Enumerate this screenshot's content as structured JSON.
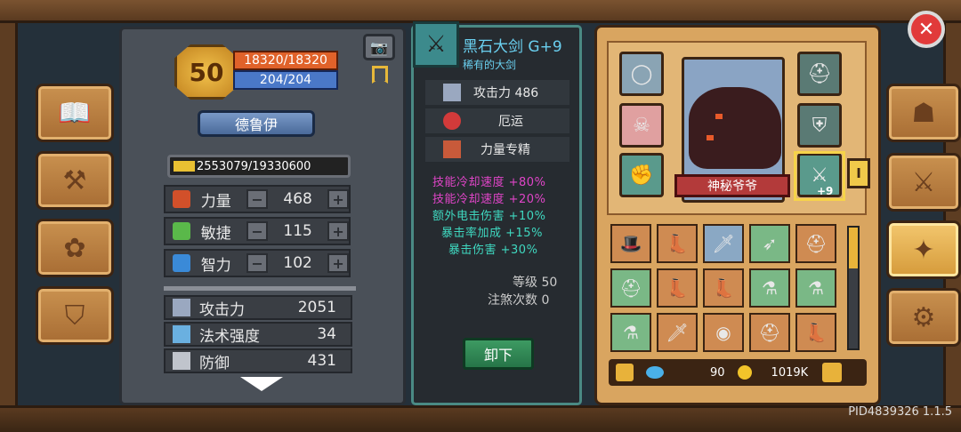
{
  "close": {
    "icon": "close-icon"
  },
  "player": {
    "level": "50",
    "hp": "18320/18320",
    "mp": "204/204",
    "class": "德鲁伊",
    "xp": "2553079/19330600"
  },
  "attributes": [
    {
      "label": "力量",
      "value": "468"
    },
    {
      "label": "敏捷",
      "value": "115"
    },
    {
      "label": "智力",
      "value": "102"
    }
  ],
  "attr_buttons": {
    "minus": "−",
    "plus": "+"
  },
  "stats": [
    {
      "label": "攻击力",
      "value": "2051"
    },
    {
      "label": "法术强度",
      "value": "34"
    },
    {
      "label": "防御",
      "value": "431"
    }
  ],
  "item": {
    "name": "黑石大剑 G+9",
    "rarity": "稀有的大剑",
    "attack": "攻击力 486",
    "trait1": "厄运",
    "trait2": "力量专精",
    "bonus_lines": [
      "技能冷却速度 +80%",
      "技能冷却速度 +20%",
      "额外电击伤害 +10%",
      "暴击率加成 +15%",
      "暴击伤害 +30%"
    ],
    "level_line": "等级 50",
    "infuse_line": "注煞次数 0",
    "unequip": "卸下"
  },
  "equip": {
    "pet_name": "神秘爷爷",
    "selected_badge": "+9",
    "tab_mark": "I"
  },
  "currency": {
    "gems": "90",
    "gold": "1019K"
  },
  "version": "PID4839326 1.1.5"
}
